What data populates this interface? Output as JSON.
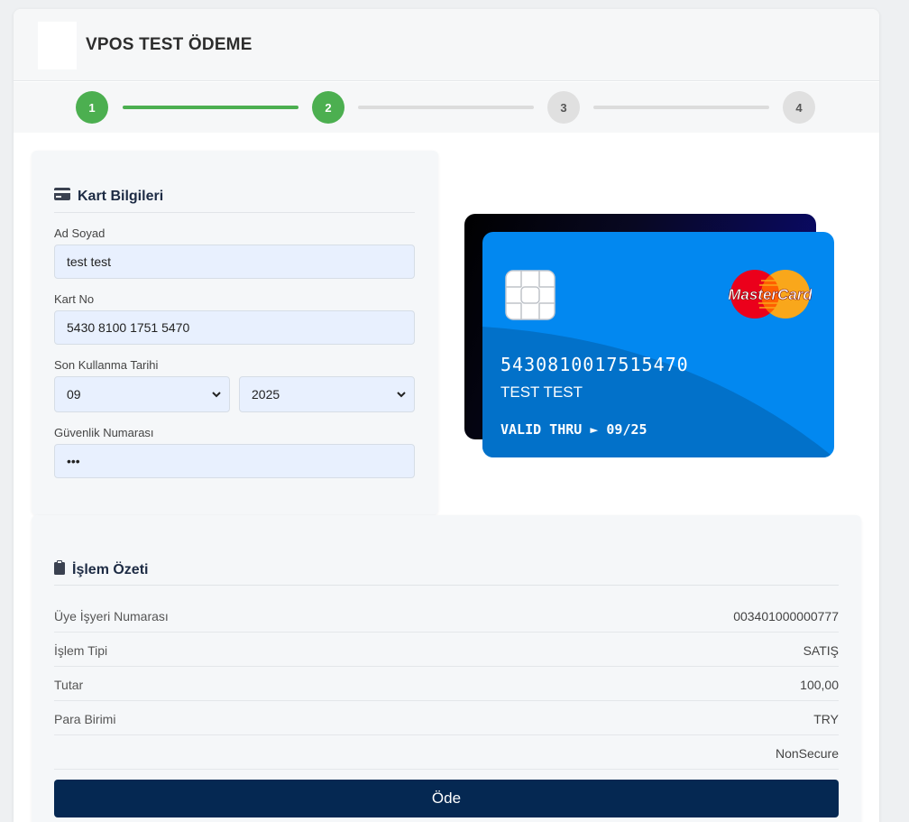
{
  "header": {
    "title": "VPOS TEST ÖDEME"
  },
  "stepper": {
    "steps": [
      {
        "label": "1",
        "state": "done"
      },
      {
        "label": "2",
        "state": "done"
      },
      {
        "label": "3",
        "state": "todo"
      },
      {
        "label": "4",
        "state": "todo"
      }
    ]
  },
  "card_form": {
    "heading": "Kart Bilgileri",
    "heading_icon": "credit-card-icon",
    "name_label": "Ad Soyad",
    "name_value": "test test",
    "number_label": "Kart No",
    "number_value": "5430 8100 1751 5470",
    "expiry_label": "Son Kullanma Tarihi",
    "expiry_month": "09",
    "expiry_year": "2025",
    "cvv_label": "Güvenlik Numarası",
    "cvv_value": "•••"
  },
  "card_preview": {
    "number": "5430810017515470",
    "holder": "TEST TEST",
    "valid_label": "VALID THRU ►",
    "valid_value": "09/25",
    "brand": "MasterCard"
  },
  "summary": {
    "heading": "İşlem Özeti",
    "heading_icon": "clipboard-icon",
    "rows": [
      {
        "key": "Üye İşyeri Numarası",
        "value": "003401000000777"
      },
      {
        "key": "İşlem Tipi",
        "value": "SATIŞ"
      },
      {
        "key": "Tutar",
        "value": "100,00"
      },
      {
        "key": "Para Birimi",
        "value": "TRY"
      },
      {
        "key": "",
        "value": "NonSecure"
      }
    ],
    "pay_label": "Öde"
  },
  "colors": {
    "accent": "#4caf50",
    "primary_button": "#052852",
    "card_blue": "#0288f0"
  }
}
